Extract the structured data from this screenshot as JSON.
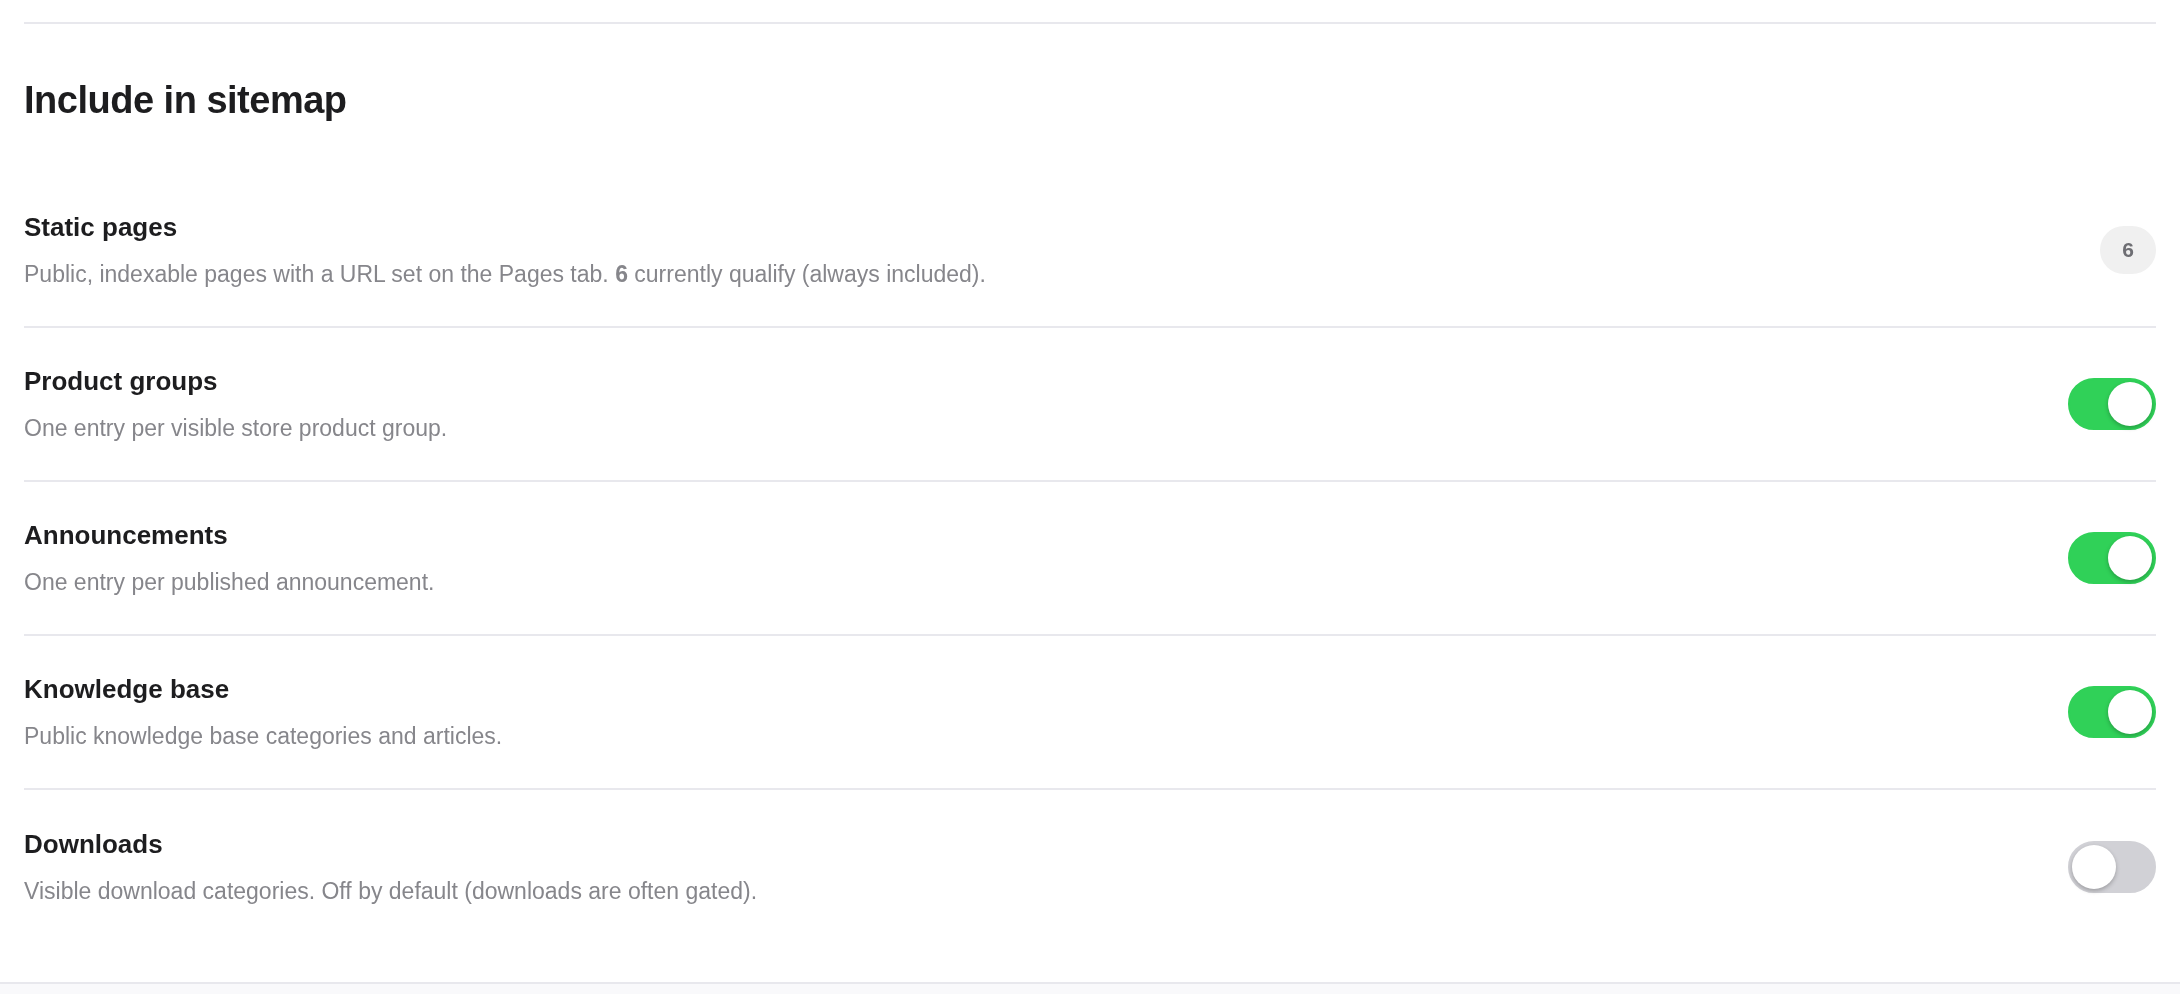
{
  "section": {
    "title": "Include in sitemap"
  },
  "rows": [
    {
      "kind": "count",
      "title": "Static pages",
      "description": "Public, indexable pages with a URL set on the Pages tab. **6** currently qualify (always included).",
      "count": "6"
    },
    {
      "kind": "toggle",
      "title": "Product groups",
      "description": "One entry per visible store product group.",
      "on": true
    },
    {
      "kind": "toggle",
      "title": "Announcements",
      "description": "One entry per published announcement.",
      "on": true
    },
    {
      "kind": "toggle",
      "title": "Knowledge base",
      "description": "Public knowledge base categories and articles.",
      "on": true
    },
    {
      "kind": "toggle",
      "title": "Downloads",
      "description": "Visible download categories. Off by default (downloads are often gated).",
      "on": false
    }
  ]
}
